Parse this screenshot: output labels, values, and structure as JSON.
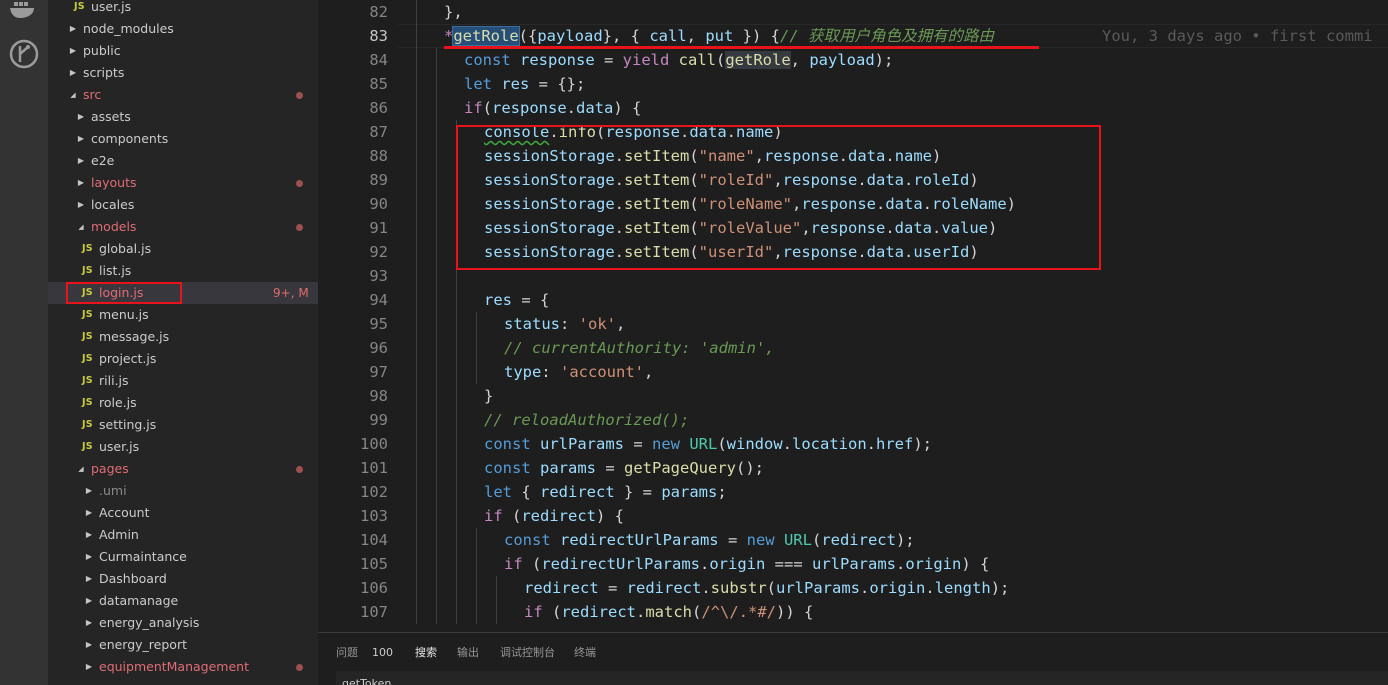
{
  "app": {
    "colors": {
      "accent_red": "#e8131b",
      "keyword": "#c586c0",
      "function": "#dcdcaa",
      "string": "#ce9178",
      "variable": "#9cdcfe",
      "comment": "#6a9955"
    }
  },
  "activity_bar": {
    "icons": [
      "docker-icon",
      "gitlens-icon"
    ]
  },
  "explorer": {
    "rows": [
      {
        "type": "file",
        "label": "user.js",
        "depth": 1
      },
      {
        "type": "folder",
        "label": "node_modules",
        "depth": 0,
        "expanded": false
      },
      {
        "type": "folder",
        "label": "public",
        "depth": 0,
        "expanded": false
      },
      {
        "type": "folder",
        "label": "scripts",
        "depth": 0,
        "expanded": false
      },
      {
        "type": "folder",
        "label": "src",
        "depth": 0,
        "expanded": true,
        "modified": true
      },
      {
        "type": "folder",
        "label": "assets",
        "depth": 1,
        "expanded": false
      },
      {
        "type": "folder",
        "label": "components",
        "depth": 1,
        "expanded": false
      },
      {
        "type": "folder",
        "label": "e2e",
        "depth": 1,
        "expanded": false
      },
      {
        "type": "folder",
        "label": "layouts",
        "depth": 1,
        "expanded": false,
        "modified": true
      },
      {
        "type": "folder",
        "label": "locales",
        "depth": 1,
        "expanded": false
      },
      {
        "type": "folder",
        "label": "models",
        "depth": 1,
        "expanded": true,
        "modified": true
      },
      {
        "type": "file",
        "label": "global.js",
        "depth": 2
      },
      {
        "type": "file",
        "label": "list.js",
        "depth": 2
      },
      {
        "type": "file",
        "label": "login.js",
        "depth": 2,
        "modified": true,
        "selected": true,
        "badge": "9+, M"
      },
      {
        "type": "file",
        "label": "menu.js",
        "depth": 2
      },
      {
        "type": "file",
        "label": "message.js",
        "depth": 2
      },
      {
        "type": "file",
        "label": "project.js",
        "depth": 2
      },
      {
        "type": "file",
        "label": "rili.js",
        "depth": 2
      },
      {
        "type": "file",
        "label": "role.js",
        "depth": 2
      },
      {
        "type": "file",
        "label": "setting.js",
        "depth": 2
      },
      {
        "type": "file",
        "label": "user.js",
        "depth": 2
      },
      {
        "type": "folder",
        "label": "pages",
        "depth": 1,
        "expanded": true,
        "modified": true
      },
      {
        "type": "folder",
        "label": ".umi",
        "depth": 2,
        "expanded": false,
        "dim": true
      },
      {
        "type": "folder",
        "label": "Account",
        "depth": 2,
        "expanded": false
      },
      {
        "type": "folder",
        "label": "Admin",
        "depth": 2,
        "expanded": false
      },
      {
        "type": "folder",
        "label": "Curmaintance",
        "depth": 2,
        "expanded": false
      },
      {
        "type": "folder",
        "label": "Dashboard",
        "depth": 2,
        "expanded": false
      },
      {
        "type": "folder",
        "label": "datamanage",
        "depth": 2,
        "expanded": false
      },
      {
        "type": "folder",
        "label": "energy_analysis",
        "depth": 2,
        "expanded": false
      },
      {
        "type": "folder",
        "label": "energy_report",
        "depth": 2,
        "expanded": false
      },
      {
        "type": "folder",
        "label": "equipmentManagement",
        "depth": 2,
        "expanded": false,
        "modified": true
      }
    ]
  },
  "editor": {
    "active_line": 83,
    "blame": "You, 3 days ago • first commi",
    "lines": [
      {
        "n": 82,
        "indent": 2,
        "tokens": [
          [
            "}",
            "gray"
          ],
          [
            ",",
            "gray"
          ]
        ]
      },
      {
        "n": 83,
        "indent": 2,
        "tokens": [
          [
            "*",
            "kw"
          ],
          [
            "getRole",
            "fn-hl"
          ],
          [
            "({",
            "gray"
          ],
          [
            "payload",
            "var"
          ],
          [
            "}, { ",
            "gray"
          ],
          [
            "call",
            "var"
          ],
          [
            ", ",
            "gray"
          ],
          [
            "put",
            "var"
          ],
          [
            " }) {",
            "gray"
          ],
          [
            "// 获取用户角色及拥有的路由",
            "cm"
          ]
        ]
      },
      {
        "n": 84,
        "indent": 3,
        "tokens": [
          [
            "const ",
            "dkw"
          ],
          [
            "response",
            "var"
          ],
          [
            " = ",
            "gray"
          ],
          [
            "yield ",
            "kw"
          ],
          [
            "call",
            "fn"
          ],
          [
            "(",
            "gray"
          ],
          [
            "getRole",
            "fn-hl2"
          ],
          [
            ", ",
            "gray"
          ],
          [
            "payload",
            "var"
          ],
          [
            ");",
            "gray"
          ]
        ]
      },
      {
        "n": 85,
        "indent": 3,
        "tokens": [
          [
            "let ",
            "dkw"
          ],
          [
            "res",
            "var"
          ],
          [
            " = {};",
            "gray"
          ]
        ]
      },
      {
        "n": 86,
        "indent": 3,
        "tokens": [
          [
            "if",
            "kw"
          ],
          [
            "(",
            "gray"
          ],
          [
            "response",
            "var"
          ],
          [
            ".",
            "gray"
          ],
          [
            "data",
            "var"
          ],
          [
            ") {",
            "gray"
          ]
        ]
      },
      {
        "n": 87,
        "indent": 4,
        "tokens": [
          [
            "console",
            "var-sq"
          ],
          [
            ".",
            "gray"
          ],
          [
            "info",
            "fn"
          ],
          [
            "(",
            "gray"
          ],
          [
            "response",
            "var"
          ],
          [
            ".",
            "gray"
          ],
          [
            "data",
            "var"
          ],
          [
            ".",
            "gray"
          ],
          [
            "name",
            "var"
          ],
          [
            ")",
            "gray"
          ]
        ]
      },
      {
        "n": 88,
        "indent": 4,
        "tokens": [
          [
            "sessionStorage",
            "var"
          ],
          [
            ".",
            "gray"
          ],
          [
            "setItem",
            "fn"
          ],
          [
            "(",
            "gray"
          ],
          [
            "\"name\"",
            "str"
          ],
          [
            ",",
            "gray"
          ],
          [
            "response",
            "var"
          ],
          [
            ".",
            "gray"
          ],
          [
            "data",
            "var"
          ],
          [
            ".",
            "gray"
          ],
          [
            "name",
            "var"
          ],
          [
            ")",
            "gray"
          ]
        ]
      },
      {
        "n": 89,
        "indent": 4,
        "tokens": [
          [
            "sessionStorage",
            "var"
          ],
          [
            ".",
            "gray"
          ],
          [
            "setItem",
            "fn"
          ],
          [
            "(",
            "gray"
          ],
          [
            "\"roleId\"",
            "str"
          ],
          [
            ",",
            "gray"
          ],
          [
            "response",
            "var"
          ],
          [
            ".",
            "gray"
          ],
          [
            "data",
            "var"
          ],
          [
            ".",
            "gray"
          ],
          [
            "roleId",
            "var"
          ],
          [
            ")",
            "gray"
          ]
        ]
      },
      {
        "n": 90,
        "indent": 4,
        "tokens": [
          [
            "sessionStorage",
            "var"
          ],
          [
            ".",
            "gray"
          ],
          [
            "setItem",
            "fn"
          ],
          [
            "(",
            "gray"
          ],
          [
            "\"roleName\"",
            "str"
          ],
          [
            ",",
            "gray"
          ],
          [
            "response",
            "var"
          ],
          [
            ".",
            "gray"
          ],
          [
            "data",
            "var"
          ],
          [
            ".",
            "gray"
          ],
          [
            "roleName",
            "var"
          ],
          [
            ")",
            "gray"
          ]
        ]
      },
      {
        "n": 91,
        "indent": 4,
        "tokens": [
          [
            "sessionStorage",
            "var"
          ],
          [
            ".",
            "gray"
          ],
          [
            "setItem",
            "fn"
          ],
          [
            "(",
            "gray"
          ],
          [
            "\"roleValue\"",
            "str"
          ],
          [
            ",",
            "gray"
          ],
          [
            "response",
            "var"
          ],
          [
            ".",
            "gray"
          ],
          [
            "data",
            "var"
          ],
          [
            ".",
            "gray"
          ],
          [
            "value",
            "var"
          ],
          [
            ")",
            "gray"
          ]
        ]
      },
      {
        "n": 92,
        "indent": 4,
        "tokens": [
          [
            "sessionStorage",
            "var"
          ],
          [
            ".",
            "gray"
          ],
          [
            "setItem",
            "fn"
          ],
          [
            "(",
            "gray"
          ],
          [
            "\"userId\"",
            "str"
          ],
          [
            ",",
            "gray"
          ],
          [
            "response",
            "var"
          ],
          [
            ".",
            "gray"
          ],
          [
            "data",
            "var"
          ],
          [
            ".",
            "gray"
          ],
          [
            "userId",
            "var"
          ],
          [
            ")",
            "gray"
          ]
        ]
      },
      {
        "n": 93,
        "indent": 4,
        "tokens": []
      },
      {
        "n": 94,
        "indent": 4,
        "tokens": [
          [
            "res",
            "var"
          ],
          [
            " = {",
            "gray"
          ]
        ]
      },
      {
        "n": 95,
        "indent": 5,
        "tokens": [
          [
            "status",
            "var"
          ],
          [
            ": ",
            "gray"
          ],
          [
            "'ok'",
            "str"
          ],
          [
            ",",
            "gray"
          ]
        ]
      },
      {
        "n": 96,
        "indent": 5,
        "tokens": [
          [
            "// currentAuthority: 'admin',",
            "cm"
          ]
        ]
      },
      {
        "n": 97,
        "indent": 5,
        "tokens": [
          [
            "type",
            "var"
          ],
          [
            ": ",
            "gray"
          ],
          [
            "'account'",
            "str"
          ],
          [
            ",",
            "gray"
          ]
        ]
      },
      {
        "n": 98,
        "indent": 4,
        "tokens": [
          [
            "}",
            "gray"
          ]
        ]
      },
      {
        "n": 99,
        "indent": 4,
        "tokens": [
          [
            "// reloadAuthorized();",
            "cm"
          ]
        ]
      },
      {
        "n": 100,
        "indent": 4,
        "tokens": [
          [
            "const ",
            "dkw"
          ],
          [
            "urlParams",
            "var"
          ],
          [
            " = ",
            "gray"
          ],
          [
            "new ",
            "dkw"
          ],
          [
            "URL",
            "cls"
          ],
          [
            "(",
            "gray"
          ],
          [
            "window",
            "var"
          ],
          [
            ".",
            "gray"
          ],
          [
            "location",
            "var"
          ],
          [
            ".",
            "gray"
          ],
          [
            "href",
            "var"
          ],
          [
            ");",
            "gray"
          ]
        ]
      },
      {
        "n": 101,
        "indent": 4,
        "tokens": [
          [
            "const ",
            "dkw"
          ],
          [
            "params",
            "var"
          ],
          [
            " = ",
            "gray"
          ],
          [
            "getPageQuery",
            "fn"
          ],
          [
            "();",
            "gray"
          ]
        ]
      },
      {
        "n": 102,
        "indent": 4,
        "tokens": [
          [
            "let ",
            "dkw"
          ],
          [
            "{ ",
            "gray"
          ],
          [
            "redirect",
            "var"
          ],
          [
            " } = ",
            "gray"
          ],
          [
            "params",
            "var"
          ],
          [
            ";",
            "gray"
          ]
        ]
      },
      {
        "n": 103,
        "indent": 4,
        "tokens": [
          [
            "if ",
            "kw"
          ],
          [
            "(",
            "gray"
          ],
          [
            "redirect",
            "var"
          ],
          [
            ") {",
            "gray"
          ]
        ]
      },
      {
        "n": 104,
        "indent": 5,
        "tokens": [
          [
            "const ",
            "dkw"
          ],
          [
            "redirectUrlParams",
            "var"
          ],
          [
            " = ",
            "gray"
          ],
          [
            "new ",
            "dkw"
          ],
          [
            "URL",
            "cls"
          ],
          [
            "(",
            "gray"
          ],
          [
            "redirect",
            "var"
          ],
          [
            ");",
            "gray"
          ]
        ]
      },
      {
        "n": 105,
        "indent": 5,
        "tokens": [
          [
            "if ",
            "kw"
          ],
          [
            "(",
            "gray"
          ],
          [
            "redirectUrlParams",
            "var"
          ],
          [
            ".",
            "gray"
          ],
          [
            "origin",
            "var"
          ],
          [
            " === ",
            "gray"
          ],
          [
            "urlParams",
            "var"
          ],
          [
            ".",
            "gray"
          ],
          [
            "origin",
            "var"
          ],
          [
            ") {",
            "gray"
          ]
        ]
      },
      {
        "n": 106,
        "indent": 6,
        "tokens": [
          [
            "redirect",
            "var"
          ],
          [
            " = ",
            "gray"
          ],
          [
            "redirect",
            "var"
          ],
          [
            ".",
            "gray"
          ],
          [
            "substr",
            "fn"
          ],
          [
            "(",
            "gray"
          ],
          [
            "urlParams",
            "var"
          ],
          [
            ".",
            "gray"
          ],
          [
            "origin",
            "var"
          ],
          [
            ".",
            "gray"
          ],
          [
            "length",
            "var"
          ],
          [
            ");",
            "gray"
          ]
        ]
      },
      {
        "n": 107,
        "indent": 6,
        "tokens": [
          [
            "if ",
            "kw"
          ],
          [
            "(",
            "gray"
          ],
          [
            "redirect",
            "var"
          ],
          [
            ".",
            "gray"
          ],
          [
            "match",
            "fn"
          ],
          [
            "(",
            "gray"
          ],
          [
            "/^\\/.*#/",
            "str"
          ],
          [
            ")) {",
            "gray"
          ]
        ]
      }
    ]
  },
  "panel": {
    "tabs": [
      {
        "label": "问题",
        "active": false
      },
      {
        "label": "搜索",
        "active": true
      },
      {
        "label": "输出",
        "active": false
      },
      {
        "label": "调试控制台",
        "active": false
      },
      {
        "label": "终端",
        "active": false
      }
    ],
    "problems_count": "100",
    "peek": "getToken"
  }
}
